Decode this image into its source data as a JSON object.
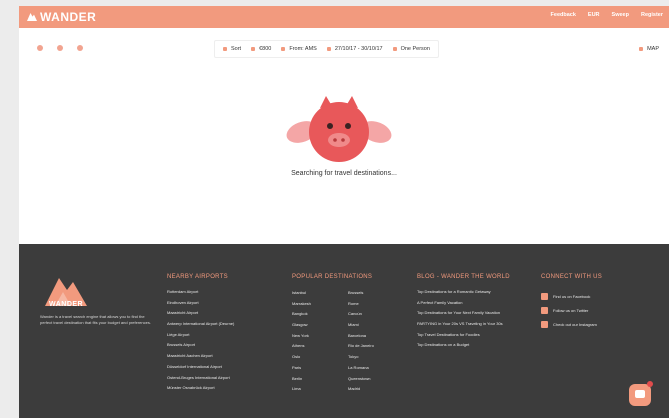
{
  "brand": {
    "name": "WANDER"
  },
  "topbar": {
    "links": [
      "Feedback",
      "EUR",
      "Sweep",
      "Register"
    ]
  },
  "toolbar": {
    "social_icons": [
      "facebook-icon",
      "twitter-icon",
      "instagram-icon"
    ],
    "filters": [
      {
        "icon": "sort-icon",
        "label": "Sort"
      },
      {
        "icon": "euro-icon",
        "label": "€800"
      },
      {
        "icon": "plane-icon",
        "label": "From: AMS"
      },
      {
        "icon": "calendar-icon",
        "label": "27/10/17 - 30/10/17"
      },
      {
        "icon": "person-icon",
        "label": "One Person"
      }
    ],
    "map_label": "MAP"
  },
  "loader": {
    "text": "Searching for travel destinations..."
  },
  "footer": {
    "brand": "WANDER",
    "about": "Wander is a travel search engine that allows you to find the perfect travel destination that fits your budget and preferences.",
    "airports": {
      "title": "NEARBY AIRPORTS",
      "items": [
        "Rotterdam Airport",
        "Eindhoven Airport",
        "Maastricht Airport",
        "Antwerp International Airport (Deurne)",
        "Liège Airport",
        "Brussels Airport",
        "Maastricht Aachen Airport",
        "Düsseldorf International Airport",
        "Ostend-Bruges International Airport",
        "Münster Osnabrück Airport"
      ]
    },
    "destinations": {
      "title": "POPULAR DESTINATIONS",
      "col1": [
        "Istanbul",
        "Marrakesh",
        "Bangkok",
        "Glasgow",
        "New York",
        "Athens",
        "Oslo",
        "Paris",
        "Berlin",
        "Lima"
      ],
      "col2": [
        "Brussels",
        "Rome",
        "Cancún",
        "Miami",
        "Barcelona",
        "Rio de Janeiro",
        "Tokyo",
        "La Romana",
        "Queenstown",
        "Madrid"
      ]
    },
    "blog": {
      "title": "BLOG - WANDER THE WORLD",
      "items": [
        "Top Destinations for a Romantic Getaway",
        "A Perfect Family Vacation",
        "Top Destinations for Your Next Family Vacation",
        "PARTYING in Your 20s VS Traveling in Your 30s",
        "Top Travel Destinations for Foodies",
        "Top Destinations on a Budget"
      ]
    },
    "connect": {
      "title": "CONNECT WITH US",
      "items": [
        {
          "icon": "facebook-icon",
          "label": "Find us on Facebook"
        },
        {
          "icon": "twitter-icon",
          "label": "Follow us on Twitter"
        },
        {
          "icon": "instagram-icon",
          "label": "Check out our Instagram"
        }
      ]
    }
  },
  "colors": {
    "accent": "#f29a7e",
    "footer_bg": "#3c3c3c",
    "pig": "#e8585a",
    "wings": "#f4a6a6"
  }
}
